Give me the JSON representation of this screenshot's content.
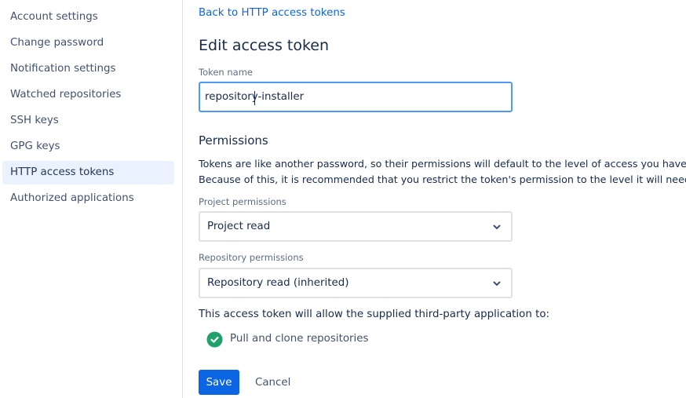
{
  "sidebar": {
    "items": [
      {
        "label": "Account settings",
        "active": false
      },
      {
        "label": "Change password",
        "active": false
      },
      {
        "label": "Notification settings",
        "active": false
      },
      {
        "label": "Watched repositories",
        "active": false
      },
      {
        "label": "SSH keys",
        "active": false
      },
      {
        "label": "GPG keys",
        "active": false
      },
      {
        "label": "HTTP access tokens",
        "active": true
      },
      {
        "label": "Authorized applications",
        "active": false
      }
    ]
  },
  "main": {
    "back_link": "Back to HTTP access tokens",
    "title": "Edit access token",
    "token_name_label": "Token name",
    "token_name_value": "repository-installer",
    "permissions_heading": "Permissions",
    "permissions_desc_line1": "Tokens are like another password, so their permissions will default to the level of access you have.",
    "permissions_desc_line2": "Because of this, it is recommended that you restrict the token's permission to the level it will need.",
    "project_permissions_label": "Project permissions",
    "project_permissions_value": "Project read",
    "repository_permissions_label": "Repository permissions",
    "repository_permissions_value": "Repository read (inherited)",
    "allow_text": "This access token will allow the supplied third-party application to:",
    "allowed_actions": [
      "Pull and clone repositories"
    ],
    "save_label": "Save",
    "cancel_label": "Cancel"
  },
  "colors": {
    "accent": "#0c66e4",
    "success": "#22a06b",
    "focus_border": "#4c9aff",
    "active_nav_bg": "#e9f2fe"
  }
}
